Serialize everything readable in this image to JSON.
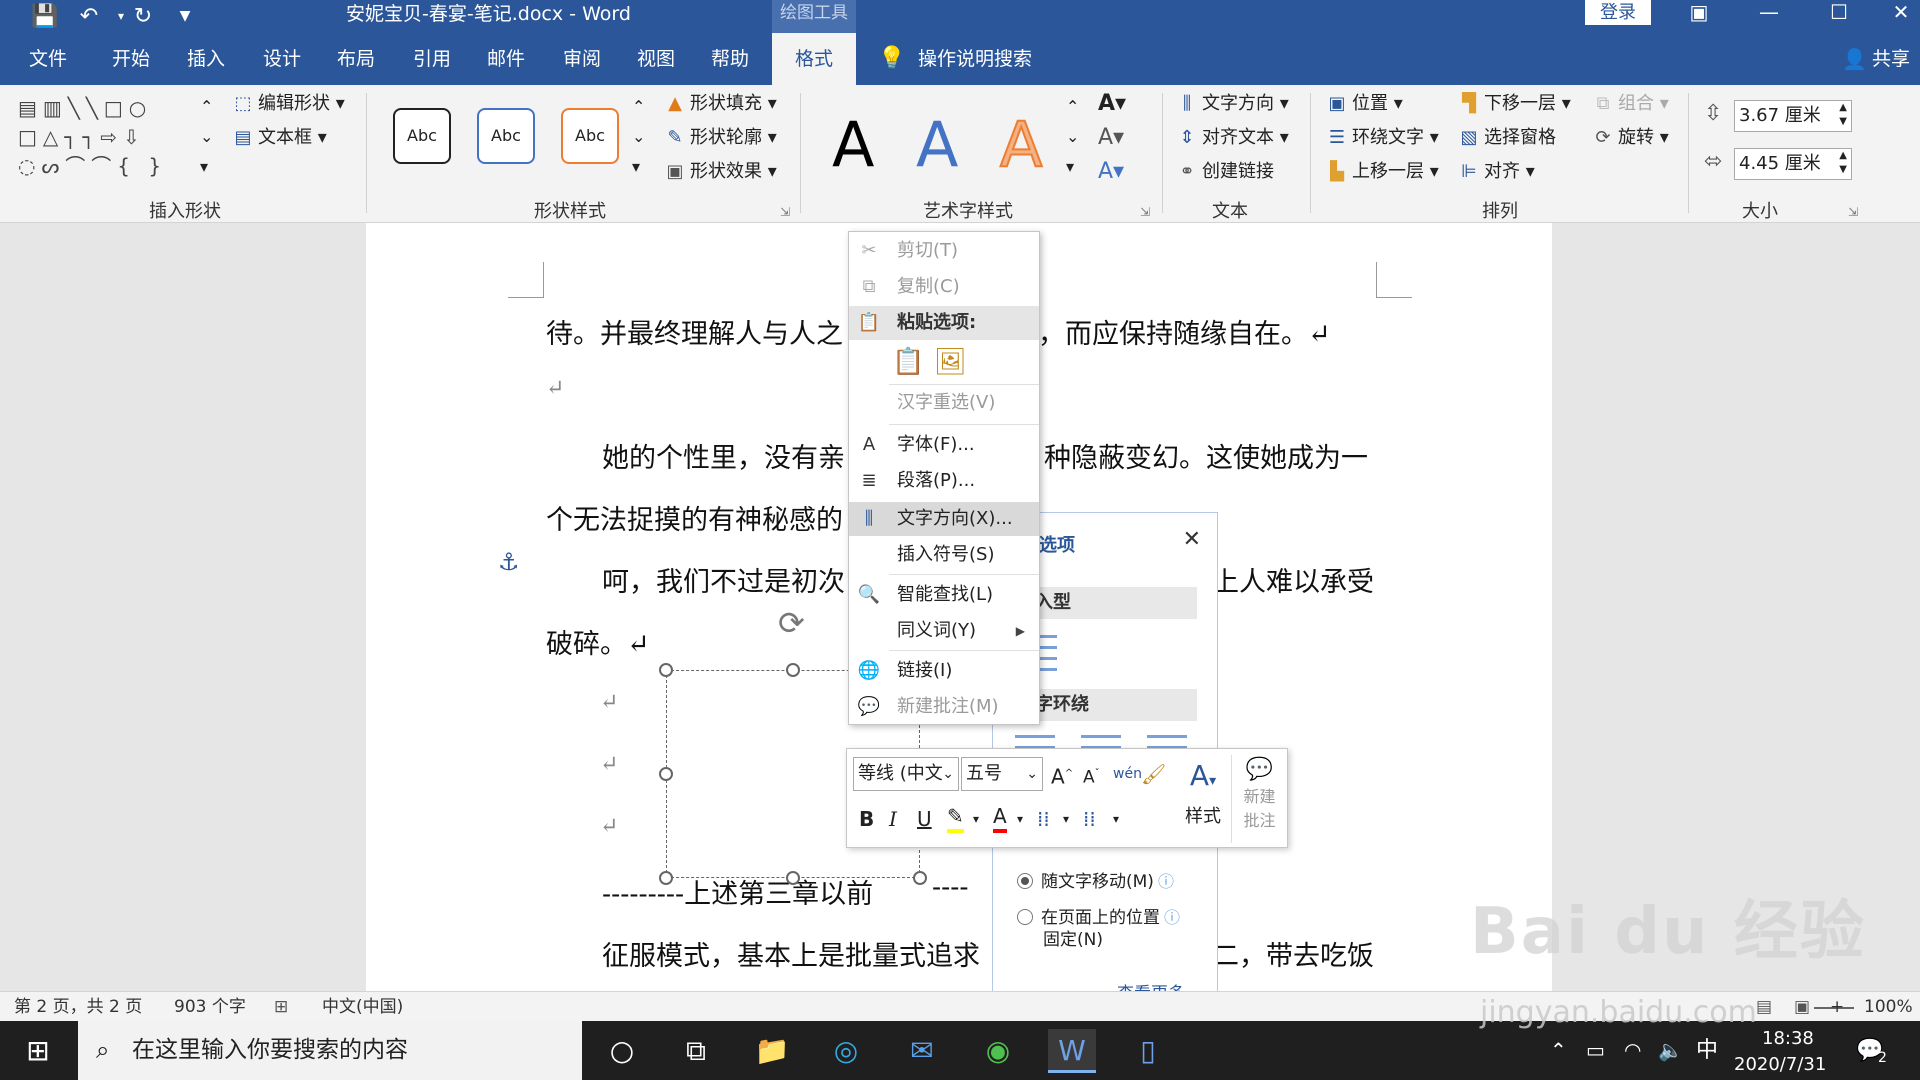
{
  "titlebar": {
    "doc_title": "安妮宝贝-春宴-笔记.docx  -  Word",
    "context_group": "绘图工具",
    "login": "登录",
    "icons": [
      "save-icon",
      "undo-icon",
      "redo-icon",
      "customize-icon"
    ]
  },
  "tabs": [
    {
      "label": "文件"
    },
    {
      "label": "开始"
    },
    {
      "label": "插入"
    },
    {
      "label": "设计"
    },
    {
      "label": "布局"
    },
    {
      "label": "引用"
    },
    {
      "label": "邮件"
    },
    {
      "label": "审阅"
    },
    {
      "label": "视图"
    },
    {
      "label": "帮助"
    },
    {
      "label": "格式"
    }
  ],
  "tell_me": "操作说明搜索",
  "share": "共享",
  "ribbon": {
    "groups": {
      "insert_shapes": "插入形状",
      "shape_styles": "形状样式",
      "wordart_styles": "艺术字样式",
      "text": "文本",
      "arrange": "排列",
      "size": "大小"
    },
    "edit_shape": "编辑形状",
    "textbox": "文本框",
    "style_sample": "Abc",
    "shape_fill": "形状填充",
    "shape_outline": "形状轮廓",
    "shape_effects": "形状效果",
    "wordart_letter": "A",
    "text_direction": "文字方向",
    "align_text": "对齐文本",
    "create_link": "创建链接",
    "position": "位置",
    "wrap_text": "环绕文字",
    "bring_forward": "上移一层",
    "send_backward": "下移一层",
    "selection_pane": "选择窗格",
    "align": "对齐",
    "group": "组合",
    "rotate": "旋转",
    "height": "3.67 厘米",
    "width": "4.45 厘米"
  },
  "document": {
    "lines": [
      "待。并最终理解人与人之",
      "，而应保持随缘自在。↵",
      "↵",
      "她的个性里，没有亲",
      "种隐蔽变幻。这使她成为一",
      "个无法捉摸的有神秘感的",
      "呵，我们不过是初次",
      "上人难以承受",
      "破碎。↵",
      "↵",
      "↵",
      "↵",
      "---------上述第三章以前",
      "----",
      "征服模式，基本上是批量式追求",
      "二，带去吃饭"
    ]
  },
  "context_menu": {
    "items": [
      {
        "label": "剪切(T)",
        "icon": "cut-icon"
      },
      {
        "label": "复制(C)",
        "icon": "copy-icon"
      },
      {
        "label": "粘贴选项:",
        "icon": "paste-icon"
      },
      {
        "label": "汉字重选(V)",
        "icon": ""
      },
      {
        "label": "字体(F)...",
        "icon": "font-icon"
      },
      {
        "label": "段落(P)...",
        "icon": "paragraph-icon"
      },
      {
        "label": "文字方向(X)...",
        "icon": "text-direction-icon"
      },
      {
        "label": "插入符号(S)",
        "icon": ""
      },
      {
        "label": "智能查找(L)",
        "icon": "smart-lookup-icon"
      },
      {
        "label": "同义词(Y)",
        "icon": ""
      },
      {
        "label": "链接(I)",
        "icon": "link-icon"
      },
      {
        "label": "新建批注(M)",
        "icon": "new-comment-icon"
      }
    ]
  },
  "layout_options": {
    "title": "选项",
    "section_inline": "入型",
    "section_wrap": "字环绕",
    "move_with_text": "随文字移动(M)",
    "fix_position_line1": "在页面上的位置",
    "fix_position_line2": "固定(N)",
    "see_more": "查看更多..."
  },
  "mini_toolbar": {
    "font": "等线 (中文",
    "size": "五号",
    "bold": "B",
    "italic": "I",
    "underline": "U",
    "styles": "样式",
    "new_comment_line1": "新建",
    "new_comment_line2": "批注"
  },
  "statusbar": {
    "page": "第 2 页，共 2 页",
    "words": "903 个字",
    "language": "中文(中国)",
    "zoom": "100%"
  },
  "taskbar": {
    "search_placeholder": "在这里输入你要搜索的内容",
    "ime": "中",
    "time": "18:38",
    "date": "2020/7/31",
    "notifications": "2"
  },
  "watermark": {
    "main": "Bai du 经验",
    "sub": "jingyan.baidu.com"
  },
  "colors": {
    "word_blue": "#2b579a",
    "ribbon_bg": "#f3f3f3",
    "taskbar_bg": "#1f1f1f"
  }
}
